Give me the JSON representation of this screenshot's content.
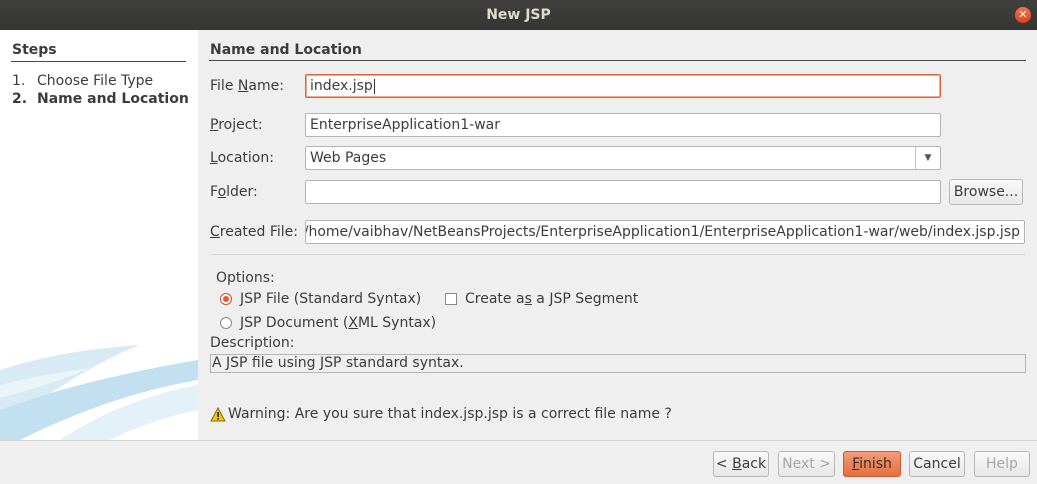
{
  "window": {
    "title": "New JSP"
  },
  "steps": {
    "title": "Steps",
    "items": [
      {
        "num": "1.",
        "label": "Choose File Type"
      },
      {
        "num": "2.",
        "label": "Name and Location"
      }
    ]
  },
  "section": {
    "title": "Name and Location"
  },
  "form": {
    "file_name_label": {
      "pre": "File ",
      "u": "N",
      "post": "ame:"
    },
    "file_name_value": "index.jsp",
    "project_label": {
      "pre": "",
      "u": "P",
      "post": "roject:"
    },
    "project_value": "EnterpriseApplication1-war",
    "location_label": {
      "pre": "",
      "u": "L",
      "post": "ocation:"
    },
    "location_value": "Web Pages",
    "folder_label": {
      "pre": "F",
      "u": "o",
      "post": "lder:"
    },
    "folder_value": "",
    "browse_label": "Browse...",
    "created_file_label": {
      "pre": "",
      "u": "C",
      "post": "reated File:"
    },
    "created_file_value": "/home/vaibhav/NetBeansProjects/EnterpriseApplication1/EnterpriseApplication1-war/web/index.jsp.jsp"
  },
  "options": {
    "label": "Options:",
    "jsp_file": {
      "pre": "",
      "u": "J",
      "post": "SP File (Standard Syntax)",
      "selected": true
    },
    "jsp_segment": {
      "pre": "Create a",
      "u": "s",
      "post": " a JSP Segment",
      "checked": false
    },
    "jsp_document": {
      "pre": "JSP Document (",
      "u": "X",
      "post": "ML Syntax)",
      "selected": false
    }
  },
  "description": {
    "label": "Description:",
    "text": "A JSP file using JSP standard syntax."
  },
  "warning": {
    "icon": "warning-icon",
    "text": "Warning: Are you sure that index.jsp.jsp is a correct file name ?"
  },
  "buttons": {
    "back": {
      "pre": "< ",
      "u": "B",
      "post": "ack"
    },
    "next": "Next >",
    "finish": {
      "pre": "",
      "u": "F",
      "post": "inish"
    },
    "cancel": "Cancel",
    "help": "Help"
  },
  "colors": {
    "accent": "#e4703f",
    "titlebar": "#3c3c3a",
    "focus_border": "#d8663e"
  }
}
